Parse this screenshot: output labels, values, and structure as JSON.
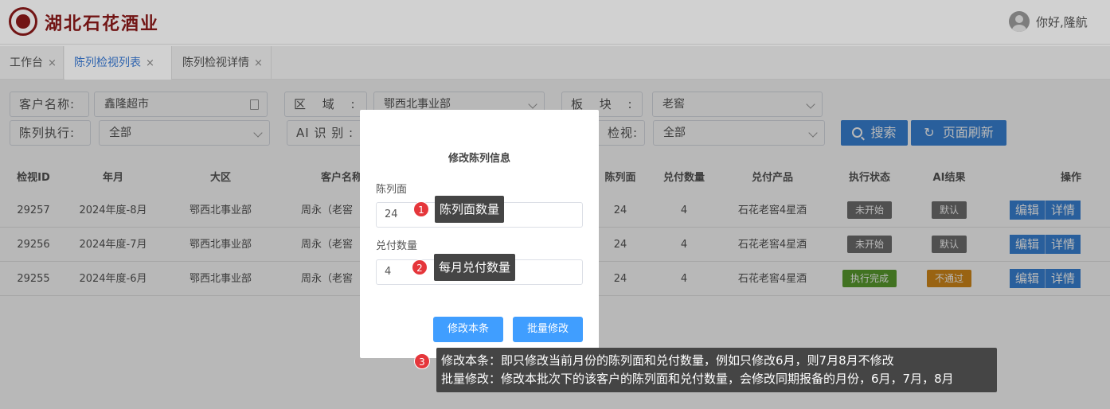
{
  "header": {
    "brand": "湖北石花酒业",
    "greeting": "你好,隆航"
  },
  "tabs": [
    {
      "label": "工作台",
      "close": "×"
    },
    {
      "label": "陈列检视列表",
      "close": "×"
    },
    {
      "label": "陈列检视详情",
      "close": "×"
    }
  ],
  "filters": {
    "customer_label": "客户名称:",
    "customer_value": "鑫隆超市",
    "region_label": "区 域 :",
    "region_value": "鄂西北事业部",
    "block_label": "板 块 :",
    "block_value": "老窖",
    "exec_label": "陈列执行:",
    "exec_value": "全部",
    "ai_label": "AI 识 别 :",
    "inspect_label": "检视:",
    "inspect_value": "全部",
    "search_button": "搜索",
    "refresh_button": "页面刷新"
  },
  "table": {
    "headers": [
      "检视ID",
      "年月",
      "大区",
      "客户名称",
      "陈列面",
      "兑付数量",
      "兑付产品",
      "执行状态",
      "AI结果",
      "操作"
    ],
    "rows": [
      {
        "id": "29257",
        "month": "2024年度-8月",
        "region": "鄂西北事业部",
        "customer": "周永（老窖",
        "faces": "24",
        "qty": "4",
        "product": "石花老窖4星酒",
        "status": "未开始",
        "ai": "默认"
      },
      {
        "id": "29256",
        "month": "2024年度-7月",
        "region": "鄂西北事业部",
        "customer": "周永（老窖",
        "faces": "24",
        "qty": "4",
        "product": "石花老窖4星酒",
        "status": "未开始",
        "ai": "默认"
      },
      {
        "id": "29255",
        "month": "2024年度-6月",
        "region": "鄂西北事业部",
        "customer": "周永（老窖",
        "faces": "24",
        "qty": "4",
        "product": "石花老窖4星酒",
        "status": "执行完成",
        "ai": "不通过"
      }
    ],
    "edit_label": "编辑",
    "detail_label": "详情"
  },
  "modal": {
    "title": "修改陈列信息",
    "faces_label": "陈列面",
    "faces_value": "24",
    "qty_label": "兑付数量",
    "qty_value": "4",
    "btn_single": "修改本条",
    "btn_batch": "批量修改"
  },
  "annotations": {
    "n1": "1",
    "t1": "陈列面数量",
    "n2": "2",
    "t2": "每月兑付数量",
    "n3": "3",
    "t3a": "修改本条：即只修改当前月份的陈列面和兑付数量，例如只修改6月，则7月8月不修改",
    "t3b": "批量修改：修改本批次下的该客户的陈列面和兑付数量，会修改同期报备的月份，6月，7月，8月"
  },
  "colors": {
    "brand": "#8b1a1a",
    "primary": "#3a84d8",
    "badge_gray": "#6f6f6f",
    "badge_green": "#5a9e2f",
    "badge_orange": "#d48a1a",
    "annotation_red": "#e5363b"
  }
}
